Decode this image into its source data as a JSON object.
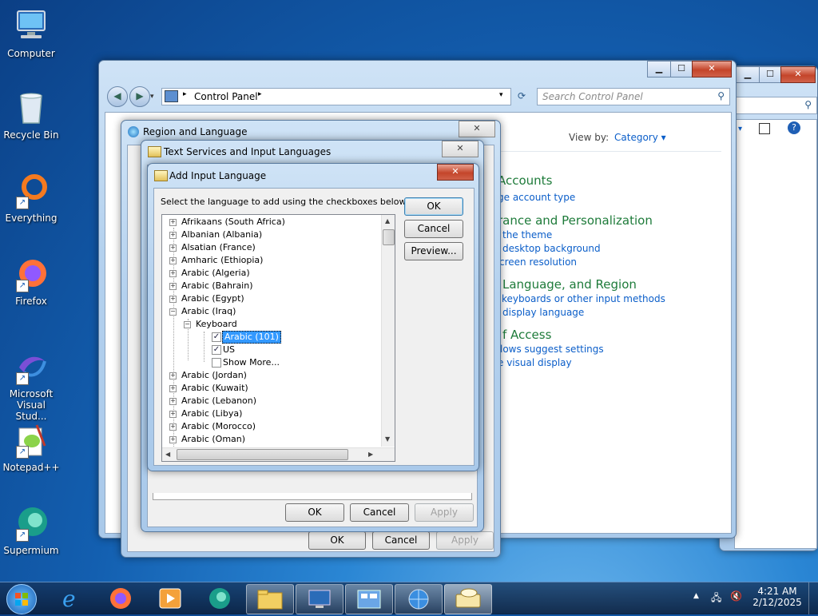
{
  "desktop": {
    "icons": [
      {
        "label": "Computer"
      },
      {
        "label": "Recycle Bin"
      },
      {
        "label": "Everything"
      },
      {
        "label": "Firefox"
      },
      {
        "label": "Microsoft Visual Stud..."
      },
      {
        "label": "Notepad++"
      },
      {
        "label": "Supermium"
      }
    ]
  },
  "control_panel": {
    "breadcrumb": "Control Panel",
    "search_placeholder": "Search Control Panel",
    "view_by_label": "View by:",
    "view_by_value": "Category",
    "sections": [
      {
        "heading": "Accounts",
        "links": [
          "ge account type"
        ]
      },
      {
        "heading": "rance and Personalization",
        "links": [
          "the theme",
          "desktop background",
          "creen resolution"
        ]
      },
      {
        "heading": "Language, and Region",
        "links": [
          "keyboards or other input methods",
          "display language"
        ]
      },
      {
        "heading": "f Access",
        "links": [
          "lows suggest settings",
          "e visual display"
        ]
      }
    ]
  },
  "region_dialog": {
    "title": "Region and Language",
    "ok": "OK",
    "cancel": "Cancel",
    "apply": "Apply"
  },
  "text_services_dialog": {
    "title": "Text Services and Input Languages",
    "ok": "OK",
    "cancel": "Cancel",
    "apply": "Apply"
  },
  "add_input_dialog": {
    "title": "Add Input Language",
    "instruction": "Select the language to add using the checkboxes below.",
    "ok": "OK",
    "cancel": "Cancel",
    "preview": "Preview...",
    "tree": {
      "before": [
        "Afrikaans (South Africa)",
        "Albanian (Albania)",
        "Alsatian (France)",
        "Amharic (Ethiopia)",
        "Arabic (Algeria)",
        "Arabic (Bahrain)",
        "Arabic (Egypt)"
      ],
      "expanded": "Arabic (Iraq)",
      "keyboard": "Keyboard",
      "options": [
        {
          "label": "Arabic (101)",
          "checked": true,
          "selected": true
        },
        {
          "label": "US",
          "checked": true,
          "selected": false
        },
        {
          "label": "Show More...",
          "checked": false,
          "selected": false
        }
      ],
      "after": [
        "Arabic (Jordan)",
        "Arabic (Kuwait)",
        "Arabic (Lebanon)",
        "Arabic (Libya)",
        "Arabic (Morocco)",
        "Arabic (Oman)"
      ]
    }
  },
  "taskbar": {
    "time": "4:21 AM",
    "date": "2/12/2025"
  },
  "colors": {
    "accent": "#3399ff",
    "link": "#0b5ec9",
    "heading": "#1e7b3a"
  }
}
